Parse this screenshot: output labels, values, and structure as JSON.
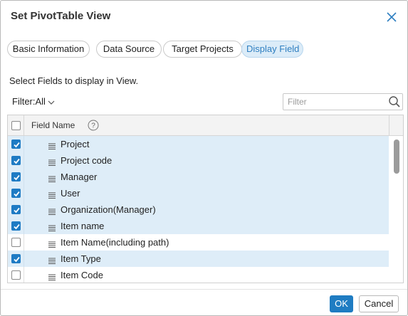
{
  "dialog": {
    "title": "Set PivotTable View",
    "close_icon": "close-icon"
  },
  "tabs": [
    {
      "label": "Basic Information",
      "active": false
    },
    {
      "label": "Data Source",
      "active": false
    },
    {
      "label": "Target Projects",
      "active": false
    },
    {
      "label": "Display Field",
      "active": true
    }
  ],
  "instruction": "Select Fields to display in View.",
  "filter": {
    "label": "Filter:All",
    "search_placeholder": "Filter",
    "search_value": ""
  },
  "grid": {
    "column_header": "Field Name",
    "select_all_checked": false,
    "rows": [
      {
        "label": "Project",
        "checked": true
      },
      {
        "label": "Project code",
        "checked": true
      },
      {
        "label": "Manager",
        "checked": true
      },
      {
        "label": "User",
        "checked": true
      },
      {
        "label": "Organization(Manager)",
        "checked": true
      },
      {
        "label": "Item name",
        "checked": true
      },
      {
        "label": "Item Name(including path)",
        "checked": false
      },
      {
        "label": "Item Type",
        "checked": true
      },
      {
        "label": "Item Code",
        "checked": false
      }
    ]
  },
  "footer": {
    "ok_label": "OK",
    "cancel_label": "Cancel"
  },
  "colors": {
    "accent": "#1f7cc2",
    "selected_row": "#deedf8",
    "active_tab_bg": "#dcecf8",
    "active_tab_text": "#2f7fc1"
  }
}
